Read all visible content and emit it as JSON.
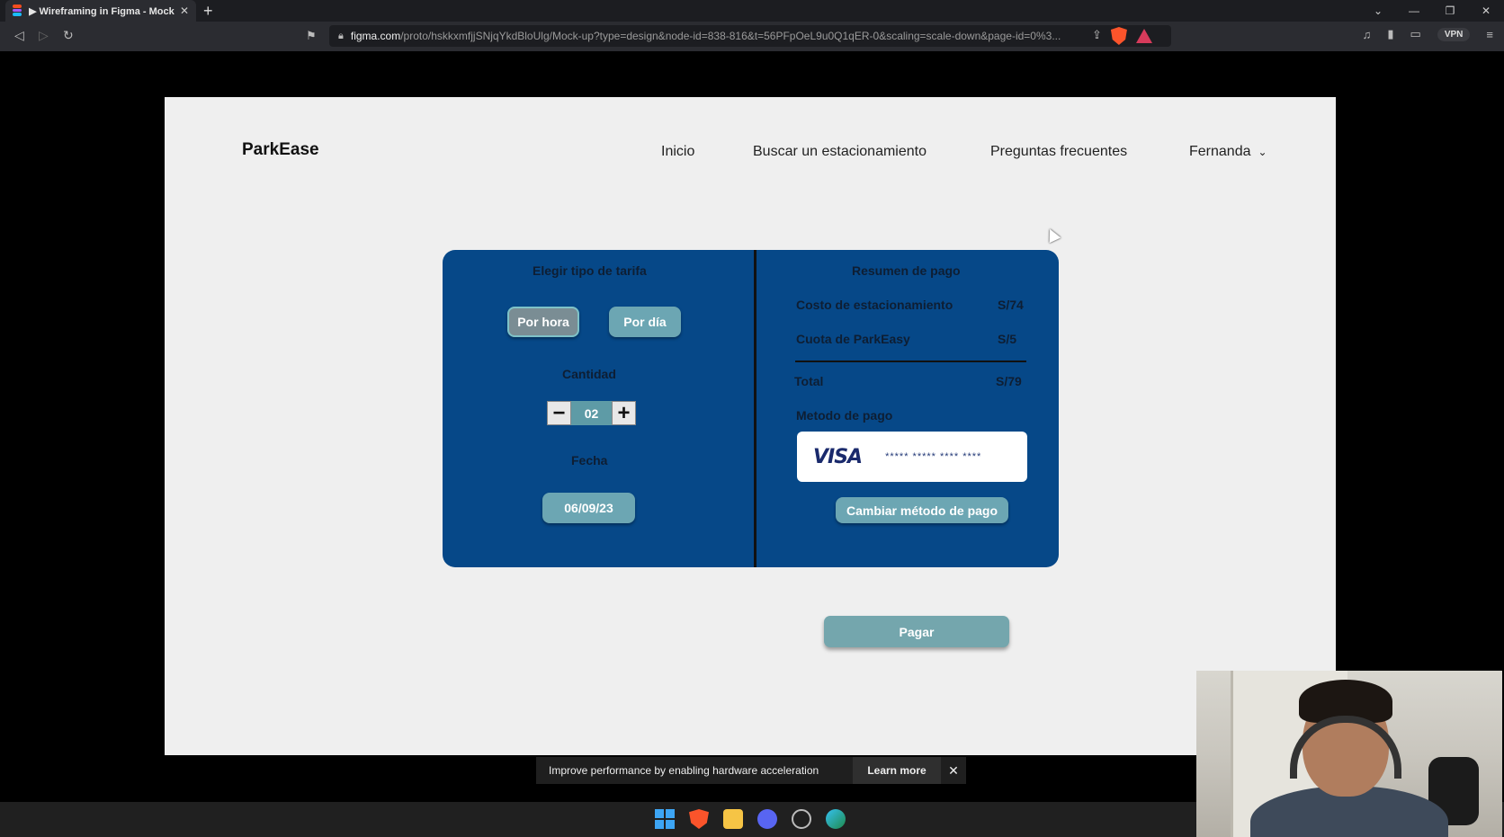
{
  "browser": {
    "tab_title": "▶ Wireframing in Figma - Mock-u",
    "url_host": "figma.com",
    "url_path": "/proto/hskkxmfjjSNjqYkdBloUlg/Mock-up?type=design&node-id=838-816&t=56PFpOeL9u0Q1qER-0&scaling=scale-down&page-id=0%3...",
    "vpn_label": "VPN"
  },
  "site": {
    "logo": "ParkEase",
    "nav": {
      "home": "Inicio",
      "search": "Buscar un estacionamiento",
      "faq": "Preguntas frecuentes",
      "user": "Fernanda"
    }
  },
  "rate": {
    "title": "Elegir tipo de tarifa",
    "by_hour": "Por hora",
    "by_day": "Por día",
    "quantity_label": "Cantidad",
    "quantity_value": "02",
    "date_label": "Fecha",
    "date_value": "06/09/23"
  },
  "summary": {
    "title": "Resumen de pago",
    "parking_cost_label": "Costo de estacionamiento",
    "parking_cost_value": "S/74",
    "fee_label": "Cuota de ParkEasy",
    "fee_value": "S/5",
    "total_label": "Total",
    "total_value": "S/79",
    "payment_method_label": "Metodo de pago",
    "card_brand": "VISA",
    "card_mask": "***** ***** **** ****",
    "change_method": "Cambiar método de pago"
  },
  "pay_button": "Pagar",
  "notification": {
    "message": "Improve performance by enabling hardware acceleration",
    "learn_more": "Learn more"
  },
  "colors": {
    "card_bg": "#064888",
    "button_teal": "#6ca6b3",
    "page_bg": "#efefef"
  }
}
